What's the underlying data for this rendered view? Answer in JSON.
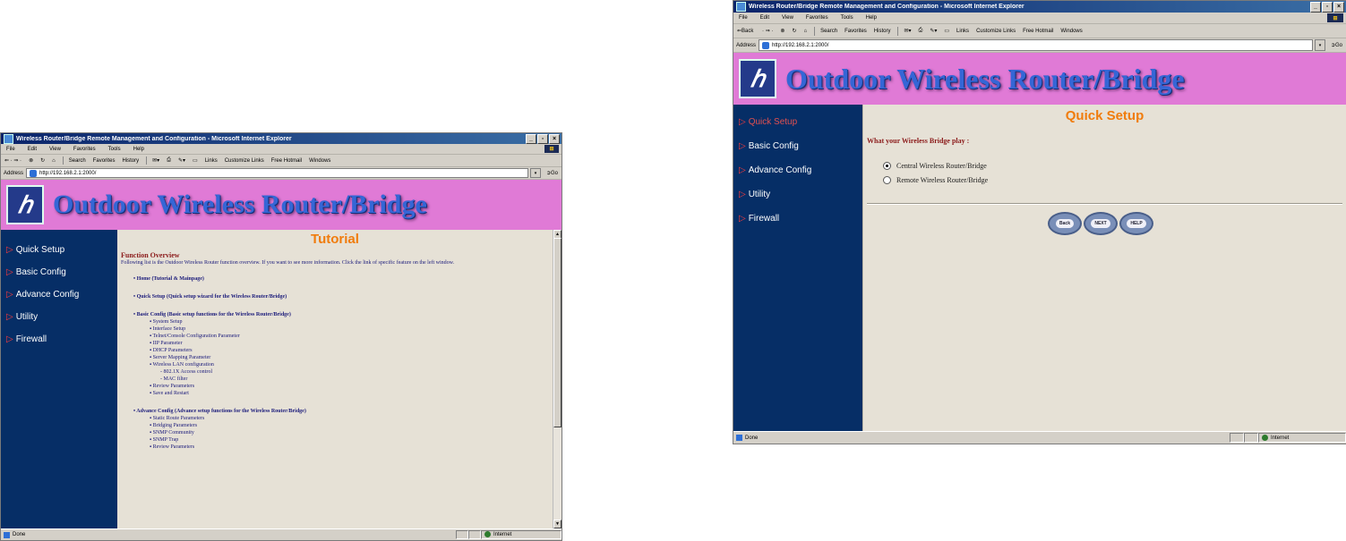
{
  "browser": {
    "title": "Wireless Router/Bridge Remote Management and Configuration - Microsoft Internet Explorer",
    "menu": [
      "File",
      "Edit",
      "View",
      "Favorites",
      "Tools",
      "Help"
    ],
    "toolbar": {
      "back": "Back",
      "search": "Search",
      "favorites": "Favorites",
      "history": "History",
      "links": "Links",
      "customize": "Customize Links",
      "hotmail": "Free Hotmail",
      "windows": "Windows"
    },
    "address_label": "Address",
    "url": "http://192.168.2.1:2000/",
    "go": "Go",
    "status_left": "Done",
    "status_zone": "Internet"
  },
  "banner_text": "Outdoor Wireless Router/Bridge",
  "nav": [
    "Quick Setup",
    "Basic Config",
    "Advance Config",
    "Utility",
    "Firewall"
  ],
  "tutorial": {
    "title": "Tutorial",
    "overview_heading": "Function Overview",
    "overview_text": "Following list is the Outdoor Wireless Router function overview. If you want to see more information. Click the link of specific feature on the left window.",
    "sections": [
      {
        "label": "Home (Tutorial & Mainpage)",
        "items": []
      },
      {
        "label": "Quick Setup (Quick setup wizard for the Wireless Router/Bridge)",
        "items": []
      },
      {
        "label": "Basic Config (Basic setup functions for the Wireless Router/Bridge)",
        "items": [
          "System Setup",
          "Interface Setup",
          "Telnet/Console Configuration Parameter",
          "IIP Parameter",
          "DHCP Parameters",
          "Server Mapping Parameter",
          "Wireless LAN configuration",
          "- 802.1X Access control",
          "- MAC filter",
          "Review Parameters",
          "Save and Restart"
        ]
      },
      {
        "label": "Advance Config (Advance setup functions for the Wireless Router/Bridge)",
        "items": [
          "Static Route Parameters",
          "Bridging Parameters",
          "SNMP Community",
          "SNMP Trap",
          "Review Parameters"
        ]
      }
    ]
  },
  "quick_setup": {
    "title": "Quick Setup",
    "question": "What your Wireless Bridge play :",
    "options": [
      {
        "label": "Central Wireless Router/Bridge",
        "selected": true
      },
      {
        "label": "Remote Wireless Router/Bridge",
        "selected": false
      }
    ],
    "buttons": [
      "Back",
      "NEXT",
      "HELP"
    ]
  }
}
